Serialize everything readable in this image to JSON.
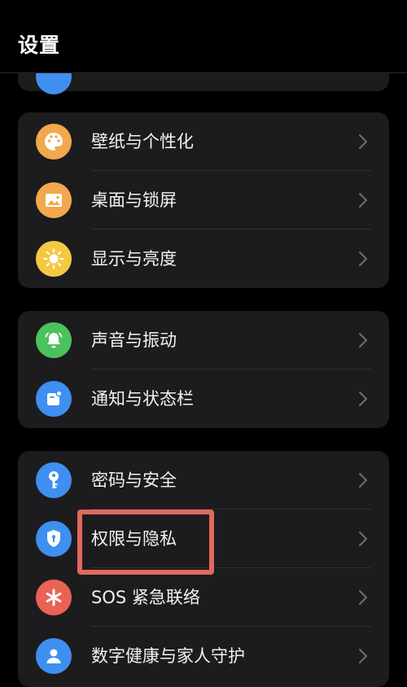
{
  "header": {
    "title": "设置"
  },
  "groups": [
    {
      "items": [
        {
          "label": "壁纸与个性化",
          "icon": "palette-icon",
          "color": "#f2a84c"
        },
        {
          "label": "桌面与锁屏",
          "icon": "image-icon",
          "color": "#f2a84c"
        },
        {
          "label": "显示与亮度",
          "icon": "sun-icon",
          "color": "#f5c842"
        }
      ]
    },
    {
      "items": [
        {
          "label": "声音与振动",
          "icon": "bell-icon",
          "color": "#4cc25c"
        },
        {
          "label": "通知与状态栏",
          "icon": "notification-icon",
          "color": "#3f8ff0"
        }
      ]
    },
    {
      "items": [
        {
          "label": "密码与安全",
          "icon": "key-icon",
          "color": "#3f8ff0"
        },
        {
          "label": "权限与隐私",
          "icon": "shield-icon",
          "color": "#3f8ff0"
        },
        {
          "label": "SOS 紧急联络",
          "icon": "asterisk-icon",
          "color": "#ea6254"
        },
        {
          "label": "数字健康与家人守护",
          "icon": "person-icon",
          "color": "#3f8ff0"
        }
      ]
    }
  ],
  "highlight_color": "#e1695c"
}
